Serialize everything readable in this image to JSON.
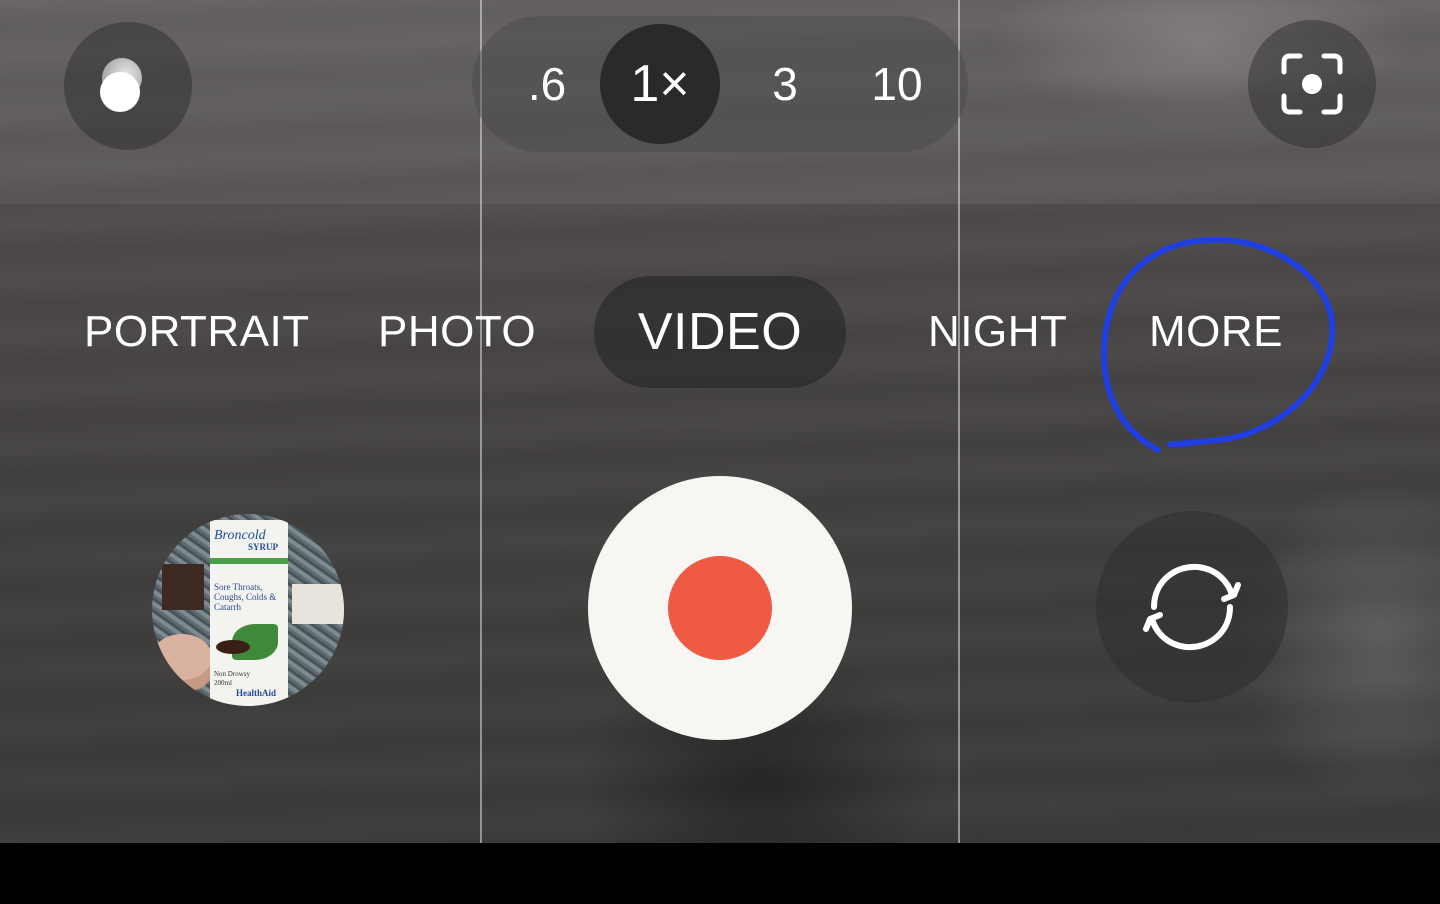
{
  "zoom": {
    "options": [
      ".6",
      "1×",
      "3",
      "10"
    ],
    "selected": "1×"
  },
  "modes": {
    "items": [
      "PORTRAIT",
      "PHOTO",
      "VIDEO",
      "NIGHT",
      "MORE"
    ],
    "selected": "VIDEO"
  },
  "icons": {
    "settings_toggle": "toggle-dot-icon",
    "focus": "focus-frame-icon",
    "flip_camera": "rotate-camera-icon",
    "record": "record-dot-icon"
  },
  "gallery_thumbnail": {
    "brand": "Broncold",
    "product": "SYRUP",
    "claim": "Sore Throats, Coughs, Colds & Catarrh",
    "note": "Non Drowsy",
    "volume": "200ml",
    "maker": "HealthAid"
  },
  "colors": {
    "record": "#ef5b42",
    "shutter": "#f7f6f2",
    "annotation": "#1f3fe0"
  }
}
